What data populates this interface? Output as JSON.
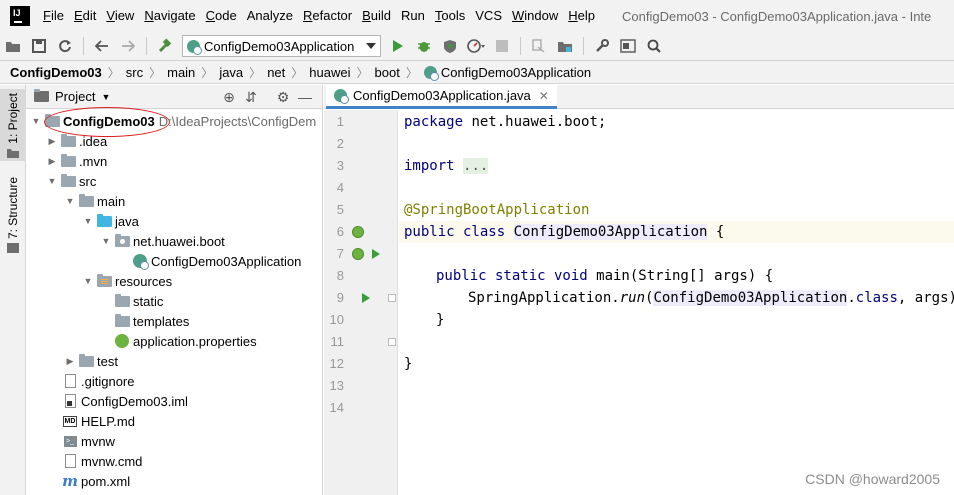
{
  "menubar": {
    "items": [
      {
        "u": "F",
        "rest": "ile"
      },
      {
        "u": "E",
        "rest": "dit"
      },
      {
        "u": "V",
        "rest": "iew"
      },
      {
        "u": "N",
        "rest": "avigate"
      },
      {
        "u": "C",
        "rest": "ode"
      },
      {
        "u": "",
        "rest": "Analyze"
      },
      {
        "u": "R",
        "rest": "efactor"
      },
      {
        "u": "B",
        "rest": "uild"
      },
      {
        "u": "",
        "rest": "Run"
      },
      {
        "u": "T",
        "rest": "ools"
      },
      {
        "u": "",
        "rest": "VCS"
      },
      {
        "u": "W",
        "rest": "indow"
      },
      {
        "u": "H",
        "rest": "elp"
      }
    ],
    "window_title": "ConfigDemo03 - ConfigDemo03Application.java - Inte"
  },
  "toolbar": {
    "run_config": "ConfigDemo03Application",
    "icons": [
      "open-icon",
      "save-icon",
      "sync-icon",
      "back-icon",
      "forward-icon",
      "build-hammer-icon",
      "run-icon",
      "debug-icon",
      "coverage-icon",
      "profile-icon",
      "stop-icon",
      "git-icon",
      "project-structure-icon",
      "settings-wrench-icon",
      "structure-icon",
      "search-icon"
    ]
  },
  "breadcrumb": [
    "ConfigDemo03",
    "src",
    "main",
    "java",
    "net",
    "huawei",
    "boot",
    "ConfigDemo03Application"
  ],
  "left_strip": {
    "project_tab": "1: Project",
    "structure_tab": "7: Structure"
  },
  "project_panel": {
    "title": "Project",
    "root_name": "ConfigDemo03",
    "root_path": "D:\\IdeaProjects\\ConfigDem",
    "tree": [
      {
        "label": ".idea"
      },
      {
        "label": ".mvn"
      },
      {
        "label": "src"
      },
      {
        "label": "main"
      },
      {
        "label": "java"
      },
      {
        "label": "net.huawei.boot"
      },
      {
        "label": "ConfigDemo03Application"
      },
      {
        "label": "resources"
      },
      {
        "label": "static"
      },
      {
        "label": "templates"
      },
      {
        "label": "application.properties"
      },
      {
        "label": "test"
      },
      {
        "label": ".gitignore"
      },
      {
        "label": "ConfigDemo03.iml"
      },
      {
        "label": "HELP.md"
      },
      {
        "label": "mvnw"
      },
      {
        "label": "mvnw.cmd"
      },
      {
        "label": "pom.xml"
      }
    ]
  },
  "editor": {
    "tab_label": "ConfigDemo03Application.java",
    "line_numbers": [
      "1",
      "2",
      "3",
      "4",
      "5",
      "6",
      "7",
      "8",
      "9",
      "10",
      "11",
      "12",
      "13",
      "14"
    ],
    "code": {
      "l1_kw": "package",
      "l1_rest": " net.huawei.boot;",
      "l3_kw": "import",
      "l3_fold": "...",
      "l6": "@SpringBootApplication",
      "l7_kw": "public class",
      "l7_name": "ConfigDemo03Application",
      "l7_rest": " {",
      "l9_kw": "public static void",
      "l9_rest": " main(String[] args) {",
      "l10_a": "SpringApplication.",
      "l10_method": "run",
      "l10_b": "(",
      "l10_cls": "ConfigDemo03Application",
      "l10_c": ".",
      "l10_kw": "class",
      "l10_d": ", args);",
      "l11": "}",
      "l13": "}"
    }
  },
  "watermark": "CSDN @howard2005",
  "colors": {
    "keyword": "#000080",
    "annotation": "#808000",
    "run_green": "#389e38",
    "annotation_circle": "#e02020"
  }
}
